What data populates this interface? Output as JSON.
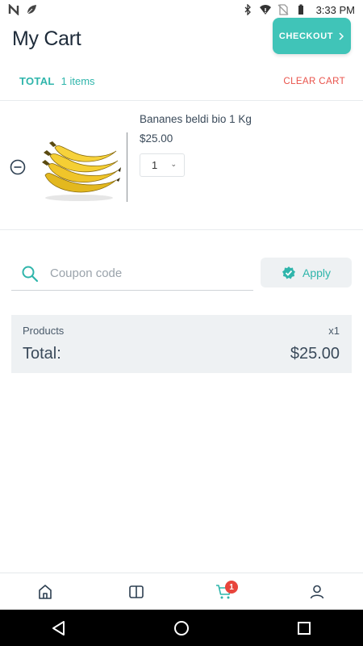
{
  "status_bar": {
    "time": "3:33 PM",
    "left_icons": [
      "n-notification-icon",
      "leaf-icon"
    ],
    "right_icons": [
      "bluetooth-icon",
      "wifi-icon",
      "no-sim-icon",
      "battery-icon"
    ]
  },
  "header": {
    "title": "My Cart",
    "checkout_label": "CHECKOUT",
    "checkout_color": "#40c4b8"
  },
  "totals_bar": {
    "total_label": "TOTAL",
    "items_count": "1 items",
    "clear_label": "CLEAR CART"
  },
  "cart_items": [
    {
      "name": "Bananes beldi bio 1 Kg",
      "price": "$25.00",
      "quantity": "1",
      "image": "bananas-image"
    }
  ],
  "coupon": {
    "placeholder": "Coupon code",
    "value": "",
    "apply_label": "Apply"
  },
  "summary": {
    "products_label": "Products",
    "products_qty": "x1",
    "total_label": "Total:",
    "total_value": "$25.00"
  },
  "tabbar": {
    "items": [
      "home-icon",
      "catalog-icon",
      "cart-icon",
      "user-icon"
    ],
    "active": "cart-icon",
    "cart_badge": "1"
  },
  "colors": {
    "accent": "#2fb5ab",
    "danger": "#e9524a",
    "badge": "#e8453c"
  }
}
